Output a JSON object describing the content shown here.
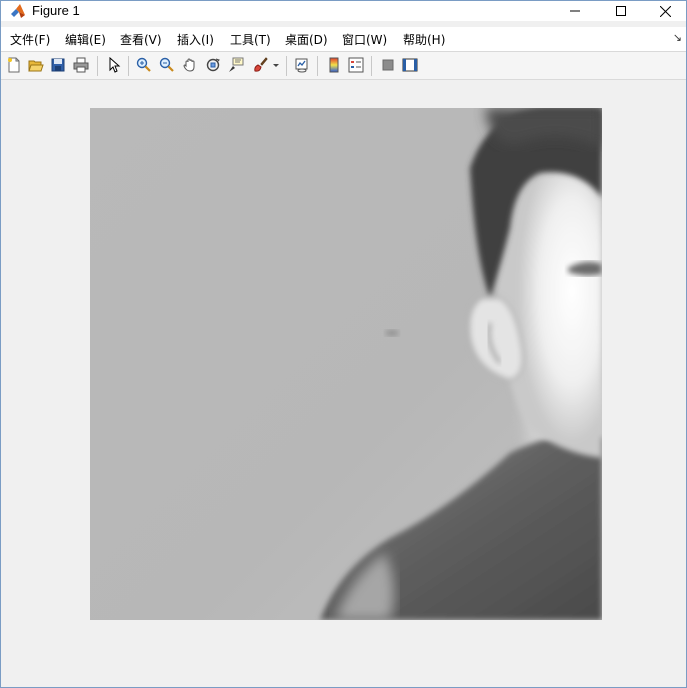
{
  "window": {
    "title": "Figure 1"
  },
  "menu": [
    {
      "label": "文件(F)"
    },
    {
      "label": "编辑(E)"
    },
    {
      "label": "查看(V)"
    },
    {
      "label": "插入(I)"
    },
    {
      "label": "工具(T)"
    },
    {
      "label": "桌面(D)"
    },
    {
      "label": "窗口(W)"
    },
    {
      "label": "帮助(H)"
    }
  ],
  "toolbar": {
    "buttons": [
      "new-figure-icon",
      "open-file-icon",
      "save-icon",
      "print-icon",
      "edit-plot-arrow-icon",
      "zoom-in-icon",
      "zoom-out-icon",
      "pan-icon",
      "rotate-3d-icon",
      "data-cursor-icon",
      "brush-icon",
      "link-plot-icon",
      "colorbar-icon",
      "legend-icon",
      "hide-plot-tools-icon",
      "show-plot-tools-icon"
    ]
  },
  "image": {
    "description_colors": {
      "background": "#b4b4b4",
      "face": "#f2f2f2",
      "hair": "#3c3c3c",
      "shirt": "#5a5a5a"
    }
  }
}
